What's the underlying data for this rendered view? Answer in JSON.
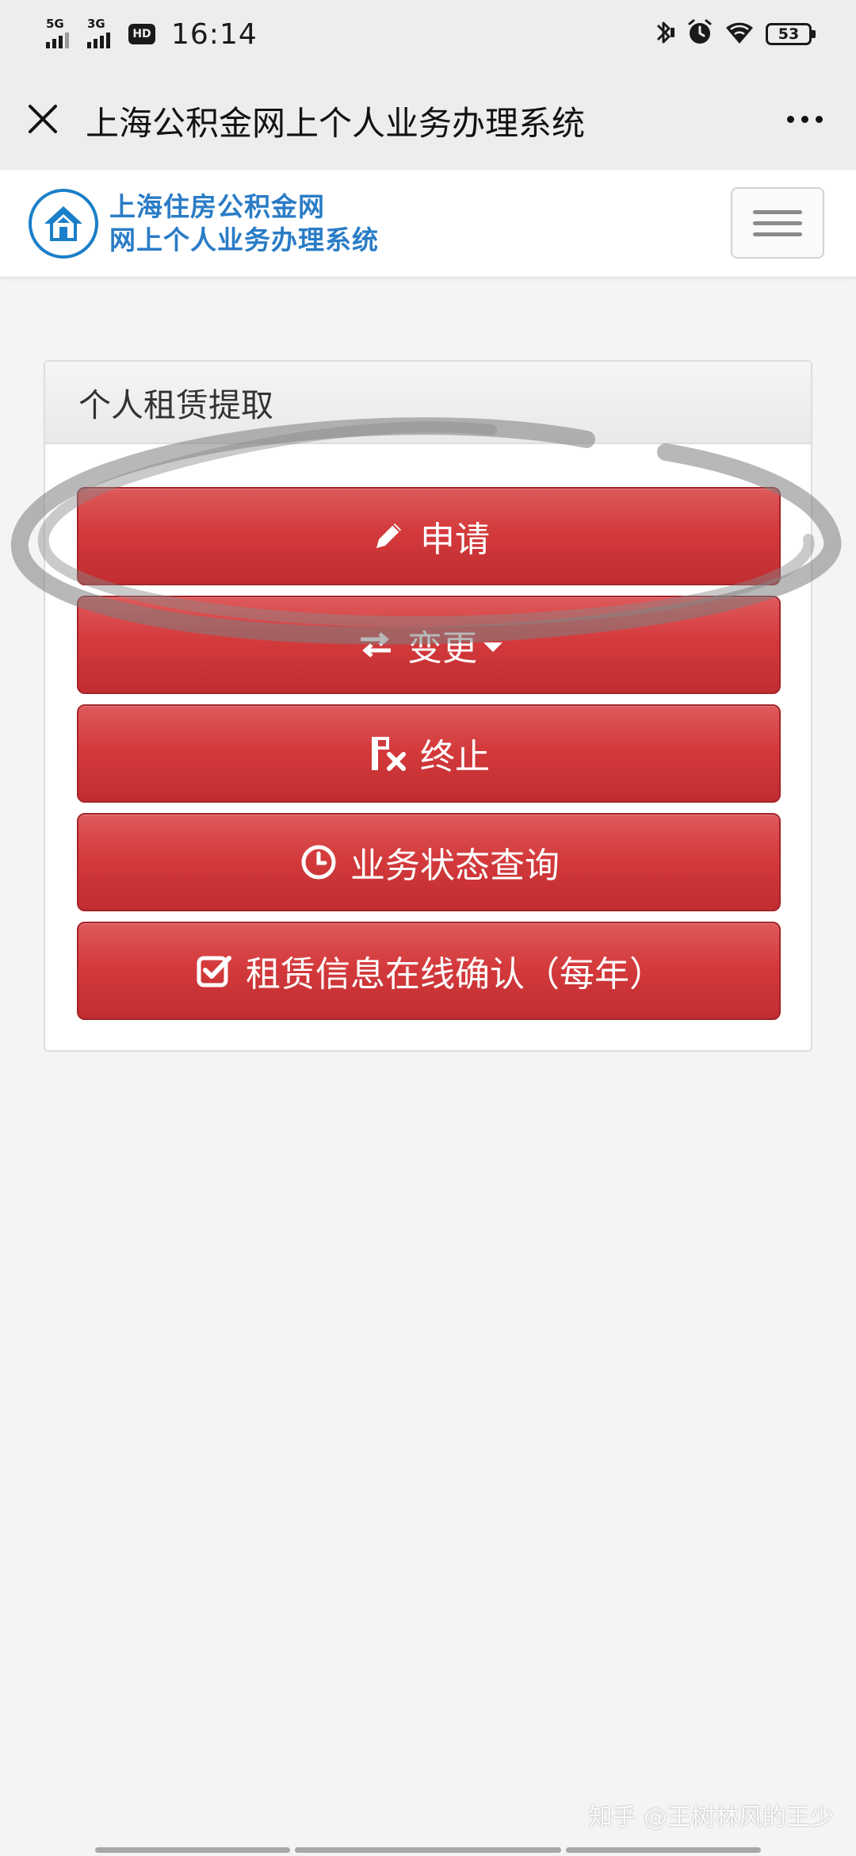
{
  "status_bar": {
    "sim1_network": "5G",
    "sim2_network": "3G",
    "hd_label": "HD",
    "time": "16:14",
    "battery_level": "53",
    "icons": [
      "signal-icon",
      "hd-icon",
      "bluetooth-icon",
      "alarm-icon",
      "wifi-icon",
      "battery-icon"
    ]
  },
  "title_bar": {
    "title": "上海公积金网上个人业务办理系统",
    "close_icon": "close-icon",
    "more_icon": "more-icon"
  },
  "site_header": {
    "logo_line1": "上海住房公积金网",
    "logo_line2": "网上个人业务办理系统",
    "menu_icon": "hamburger-menu-icon",
    "brand_color": "#2a7cc6"
  },
  "panel": {
    "heading": "个人租赁提取",
    "buttons": [
      {
        "label": "申请",
        "icon": "pencil-icon"
      },
      {
        "label": "变更",
        "icon": "exchange-icon",
        "has_dropdown": true
      },
      {
        "label": "终止",
        "icon": "terminate-icon"
      },
      {
        "label": "业务状态查询",
        "icon": "clock-icon"
      },
      {
        "label": "租赁信息在线确认（每年）",
        "icon": "check-square-icon"
      }
    ],
    "button_color": "#d43a3c"
  },
  "watermark": "知乎 @王树林风的王少"
}
